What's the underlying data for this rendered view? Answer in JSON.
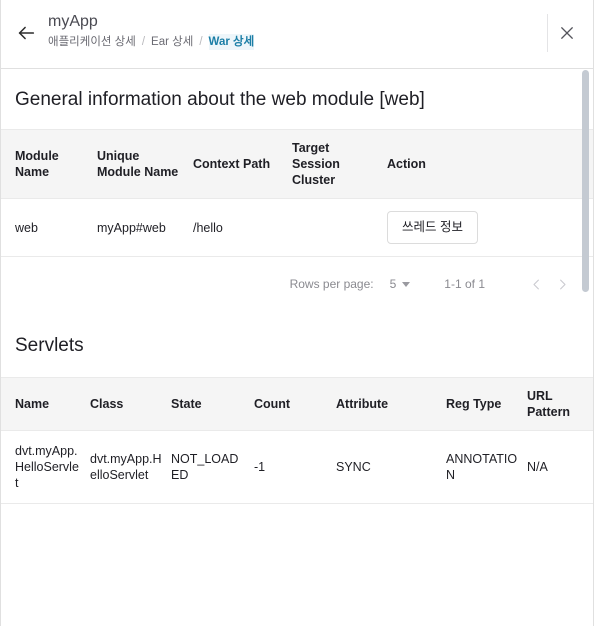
{
  "header": {
    "back_icon": "arrow-left-icon",
    "title": "myApp",
    "close_icon": "close-icon",
    "breadcrumb": [
      {
        "label": "애플리케이션 상세",
        "active": false
      },
      {
        "label": "Ear 상세",
        "active": false
      },
      {
        "label": "War 상세",
        "active": true
      }
    ],
    "separator": "/"
  },
  "module_section": {
    "title": "General information about the web module [web]",
    "columns": [
      "Module Name",
      "Unique Module Name",
      "Context Path",
      "Target Session Cluster",
      "Action"
    ],
    "rows": [
      {
        "module_name": "web",
        "unique_module_name": "myApp#web",
        "context_path": "/hello",
        "target_session_cluster": "",
        "action_label": "쓰레드 정보"
      }
    ],
    "pagination": {
      "rows_per_page_label": "Rows per page:",
      "rows_per_page_value": "5",
      "range": "1-1 of 1",
      "prev_icon": "chevron-left-icon",
      "next_icon": "chevron-right-icon"
    }
  },
  "servlets_section": {
    "title": "Servlets",
    "columns": [
      "Name",
      "Class",
      "State",
      "Count",
      "Attribute",
      "Reg Type",
      "URL Pattern"
    ],
    "rows": [
      {
        "name": "dvt.myApp.HelloServlet",
        "class": "dvt.myApp.HelloServlet",
        "state": "NOT_LOADED",
        "count": "-1",
        "attribute": "SYNC",
        "reg_type": "ANNOTATION",
        "url_pattern": "N/A"
      }
    ]
  },
  "colors": {
    "accent": "#1b7ea6",
    "header_bg": "#f5f5f5",
    "border": "#eaeaea",
    "text": "#1f1f25",
    "muted": "#8a8a90",
    "scrollbar": "#c4cad2"
  }
}
